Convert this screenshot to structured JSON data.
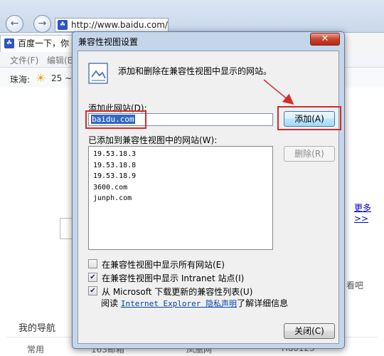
{
  "browser": {
    "url": "http://www.baidu.com/",
    "tab_title": "百度一下，你",
    "menu": [
      "文件(F)",
      "编辑(E)"
    ],
    "weather_city": "珠海:",
    "weather_temp": "25 ~",
    "more_link": "更多>>",
    "look_text": "看吧",
    "my_nav": "我的导航",
    "common_label": "常用",
    "sites": [
      "163邮箱",
      "凤凰网",
      "Hao123"
    ],
    "colors": {
      "accent": "#3368c2",
      "annotation": "#d52b2b"
    }
  },
  "dialog": {
    "title": "兼容性视图设置",
    "close_glyph": "✕",
    "header_text": "添加和删除在兼容性视图中显示的网站。",
    "add_label": "添加此网站(D):",
    "add_value": "baidu.com",
    "add_button": "添加(A)",
    "list_label": "已添加到兼容性视图中的网站(W):",
    "sites": [
      "19.53.18.3",
      "19.53.18.8",
      "19.53.18.9",
      "3600.com",
      "junph.com"
    ],
    "remove_button": "删除(R)",
    "check_all": {
      "label": "在兼容性视图中显示所有网站(E)",
      "checked": false
    },
    "check_intranet": {
      "label": "在兼容性视图中显示 Intranet 站点(I)",
      "checked": true
    },
    "check_download": {
      "label": "从 Microsoft 下载更新的兼容性列表(U)",
      "checked": true
    },
    "privacy_prefix": "阅读",
    "privacy_link": "Internet Explorer 隐私声明",
    "privacy_suffix": "了解详细信息",
    "close_button": "关闭(C)"
  }
}
